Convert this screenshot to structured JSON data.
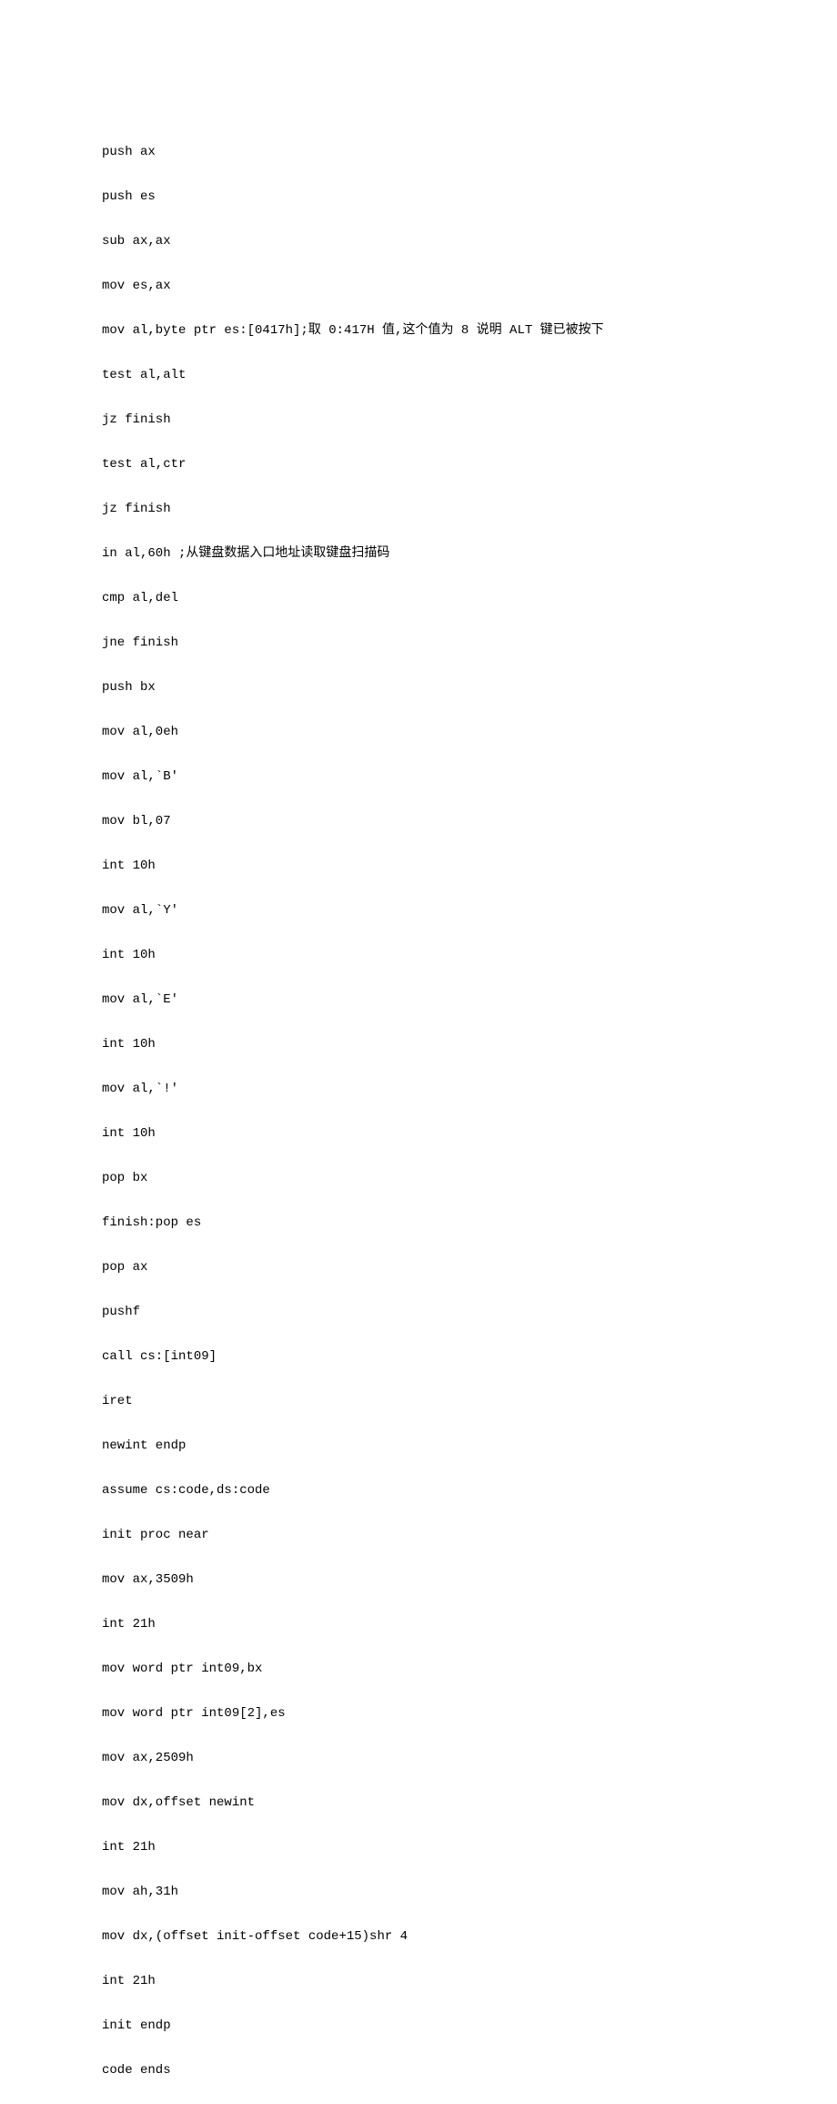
{
  "lines": [
    "push ax",
    "push es",
    "sub ax,ax",
    "mov es,ax",
    "mov al,byte ptr es:[0417h];取 0:417H 值,这个值为 8 说明 ALT 键已被按下",
    "test al,alt",
    "jz finish",
    "test al,ctr",
    "jz finish",
    "in al,60h ;从键盘数据入口地址读取键盘扫描码",
    "cmp al,del",
    "jne finish",
    "push bx",
    "mov al,0eh",
    "mov al,`B'",
    "mov bl,07",
    "int 10h",
    "mov al,`Y'",
    "int 10h",
    "mov al,`E'",
    "int 10h",
    "mov al,`!'",
    "int 10h",
    "pop bx",
    "finish:pop es",
    "pop ax",
    "pushf",
    "call cs:[int09]",
    "iret",
    "newint endp",
    "assume cs:code,ds:code",
    "init proc near",
    "mov ax,3509h",
    "int 21h",
    "mov word ptr int09,bx",
    "mov word ptr int09[2],es",
    "mov ax,2509h",
    "mov dx,offset newint",
    "int 21h",
    "mov ah,31h",
    "mov dx,(offset init-offset code+15)shr 4",
    "int 21h",
    "init endp",
    "code ends"
  ]
}
